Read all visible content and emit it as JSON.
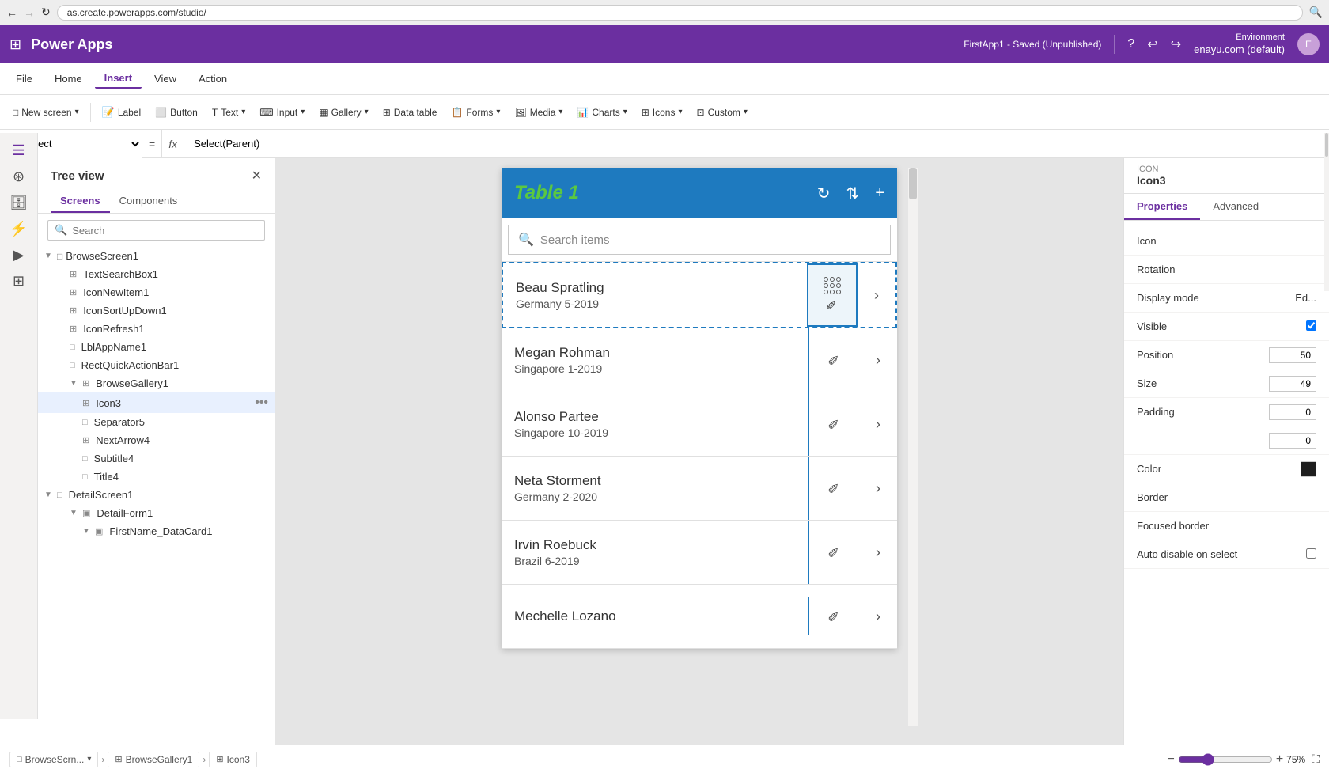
{
  "browser": {
    "url": "as.create.powerapps.com/studio/",
    "back_btn": "←",
    "forward_btn": "→",
    "refresh_btn": "↻"
  },
  "topbar": {
    "grid_icon": "⊞",
    "app_name": "Power Apps",
    "env_label": "Environment",
    "env_name": "enayu.com (default)",
    "saved_status": "FirstApp1 - Saved (Unpublished)"
  },
  "menubar": {
    "items": [
      "File",
      "Home",
      "Insert",
      "View",
      "Action"
    ],
    "active_item": "Insert"
  },
  "toolbar": {
    "new_screen_label": "New screen",
    "label_btn": "Label",
    "button_btn": "Button",
    "text_btn": "Text",
    "input_btn": "Input",
    "gallery_btn": "Gallery",
    "data_table_btn": "Data table",
    "forms_btn": "Forms",
    "media_btn": "Media",
    "charts_btn": "Charts",
    "icons_btn": "Icons",
    "custom_btn": "Custom"
  },
  "formula_bar": {
    "select_value": "OnSelect",
    "eq_symbol": "=",
    "fx_symbol": "fx",
    "formula_value": "Select(Parent)"
  },
  "sidebar": {
    "title": "Tree view",
    "close_btn": "✕",
    "tabs": [
      "Screens",
      "Components"
    ],
    "active_tab": "Screens",
    "search_placeholder": "Search",
    "tree_items": [
      {
        "id": "TextSearchBox1",
        "label": "TextSearchBox1",
        "indent": 2,
        "icon": "⊞",
        "type": "text"
      },
      {
        "id": "IconNewItem1",
        "label": "IconNewItem1",
        "indent": 2,
        "icon": "⊞",
        "type": "icon"
      },
      {
        "id": "IconSortUpDown1",
        "label": "IconSortUpDown1",
        "indent": 2,
        "icon": "⊞",
        "type": "icon"
      },
      {
        "id": "IconRefresh1",
        "label": "IconRefresh1",
        "indent": 2,
        "icon": "⊞",
        "type": "icon"
      },
      {
        "id": "LblAppName1",
        "label": "LblAppName1",
        "indent": 2,
        "icon": "□",
        "type": "label"
      },
      {
        "id": "RectQuickActionBar1",
        "label": "RectQuickActionBar1",
        "indent": 2,
        "icon": "□",
        "type": "rect"
      },
      {
        "id": "BrowseGallery1",
        "label": "BrowseGallery1",
        "indent": 2,
        "icon": "⊞",
        "type": "gallery",
        "expanded": true
      },
      {
        "id": "Icon3",
        "label": "Icon3",
        "indent": 3,
        "icon": "⊞",
        "type": "icon",
        "selected": true,
        "has_more": true
      },
      {
        "id": "Separator5",
        "label": "Separator5",
        "indent": 3,
        "icon": "□",
        "type": "separator"
      },
      {
        "id": "NextArrow4",
        "label": "NextArrow4",
        "indent": 3,
        "icon": "⊞",
        "type": "icon"
      },
      {
        "id": "Subtitle4",
        "label": "Subtitle4",
        "indent": 3,
        "icon": "□",
        "type": "label"
      },
      {
        "id": "Title4",
        "label": "Title4",
        "indent": 3,
        "icon": "□",
        "type": "label"
      },
      {
        "id": "DetailScreen1",
        "label": "DetailScreen1",
        "indent": 1,
        "icon": "□",
        "type": "screen",
        "expanded": true
      },
      {
        "id": "DetailForm1",
        "label": "DetailForm1",
        "indent": 2,
        "icon": "▣",
        "type": "form",
        "expanded": true
      },
      {
        "id": "FirstName_DataCard1",
        "label": "FirstName_DataCard1",
        "indent": 3,
        "icon": "▣",
        "type": "datacard"
      }
    ]
  },
  "canvas": {
    "app_title": "Table 1",
    "search_placeholder": "Search items",
    "gallery_items": [
      {
        "name": "Beau Spratling",
        "subtitle": "Germany 5-2019",
        "selected": true
      },
      {
        "name": "Megan Rohman",
        "subtitle": "Singapore 1-2019"
      },
      {
        "name": "Alonso Partee",
        "subtitle": "Singapore 10-2019"
      },
      {
        "name": "Neta Storment",
        "subtitle": "Germany 2-2020"
      },
      {
        "name": "Irvin Roebuck",
        "subtitle": "Brazil 6-2019"
      },
      {
        "name": "Mechelle Lozano",
        "subtitle": ""
      }
    ]
  },
  "right_panel": {
    "icon_label": "ICON",
    "icon_value": "Icon3",
    "tabs": [
      "Properties",
      "Advanced"
    ],
    "active_tab": "Properties",
    "props": [
      {
        "label": "Icon",
        "value": ""
      },
      {
        "label": "Rotation",
        "value": ""
      },
      {
        "label": "Display mode",
        "value": "Ed..."
      },
      {
        "label": "Visible",
        "value": ""
      },
      {
        "label": "Position",
        "value": "50"
      },
      {
        "label": "Size",
        "value": "49"
      },
      {
        "label": "Padding",
        "value": "0"
      },
      {
        "label": "",
        "value": "0"
      },
      {
        "label": "Color",
        "value": ""
      },
      {
        "label": "Border",
        "value": ""
      },
      {
        "label": "Focused border",
        "value": ""
      },
      {
        "label": "Auto disable on select",
        "value": ""
      }
    ]
  },
  "status_bar": {
    "breadcrumbs": [
      "BrowseScrn...",
      "BrowseGallery1",
      "Icon3"
    ],
    "breadcrumb_icons": [
      "□",
      "⊞",
      "⊞"
    ],
    "zoom_minus": "−",
    "zoom_plus": "+",
    "zoom_value": "75",
    "zoom_unit": "%",
    "fullscreen_icon": "⛶"
  }
}
